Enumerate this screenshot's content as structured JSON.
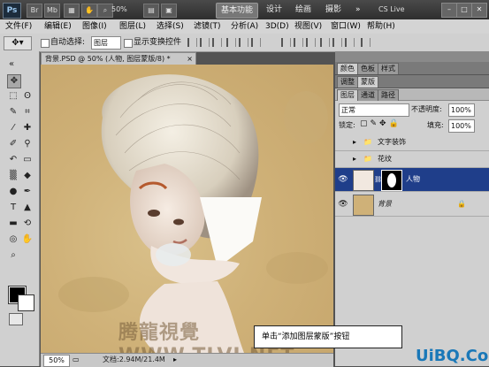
{
  "app": {
    "logo": "Ps",
    "zoom": "50%",
    "workspaces": [
      "基本功能",
      "设计",
      "绘画",
      "摄影"
    ],
    "active_workspace": "基本功能",
    "cs_live": "CS Live"
  },
  "menu": [
    "文件(F)",
    "编辑(E)",
    "图像(I)",
    "图层(L)",
    "选择(S)",
    "滤镜(T)",
    "分析(A)",
    "3D(D)",
    "视图(V)",
    "窗口(W)",
    "帮助(H)"
  ],
  "options": {
    "auto_select_label": "自动选择:",
    "auto_select_value": "图层",
    "show_transform_label": "显示变换控件"
  },
  "document": {
    "tab_title": "背景.PSD @ 50% (人物, 图层蒙版/8) *",
    "zoom": "50%",
    "doc_size": "文档:2.94M/21.4M"
  },
  "panels": {
    "top_tabs": [
      "颜色",
      "色板",
      "样式"
    ],
    "second_tabs": [
      "调整",
      "蒙版"
    ],
    "layers_tabs": [
      "图层",
      "通道",
      "路径"
    ],
    "blend_mode": "正常",
    "opacity_label": "不透明度:",
    "opacity": "100%",
    "lock_label": "锁定:",
    "fill_label": "填充:",
    "fill": "100%",
    "layers": [
      {
        "name": "文字装饰",
        "type": "group"
      },
      {
        "name": "花纹",
        "type": "group"
      },
      {
        "name": "人物",
        "type": "layer-mask",
        "selected": true
      },
      {
        "name": "背景",
        "type": "background",
        "locked": true
      }
    ]
  },
  "callout": "单击“添加图层蒙版”按钮",
  "watermark": "腾龍視覺WWW.TLVI.NET",
  "corner_watermark": "UiBQ.CoM"
}
